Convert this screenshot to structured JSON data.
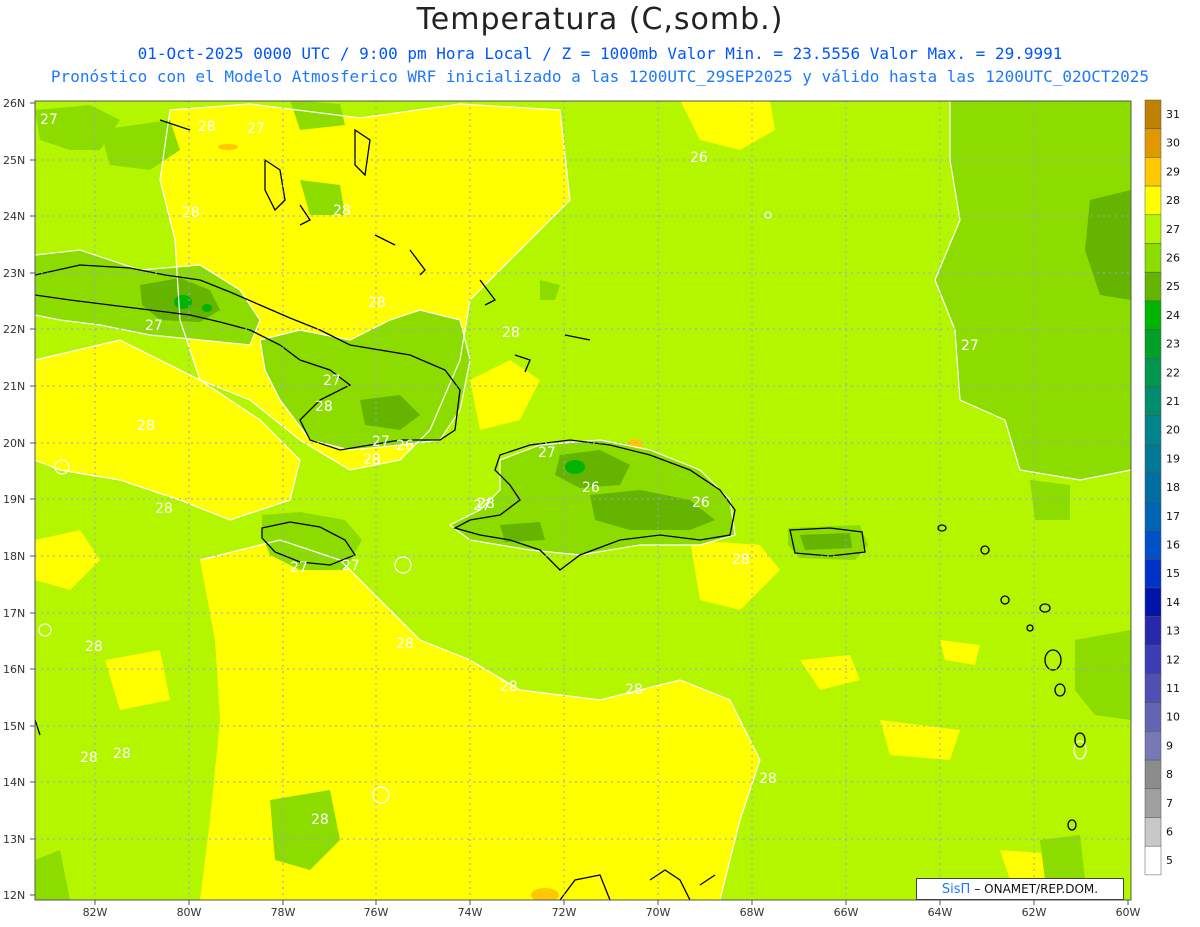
{
  "header": {
    "title": "Temperatura (C,somb.)",
    "subtitle1": "01-Oct-2025  0000 UTC / 9:00 pm Hora Local / Z = 1000mb   Valor Min. = 23.5556  Valor Max. = 29.9991",
    "subtitle2": "Pronóstico con el Modelo Atmosferico WRF inicializado a las 1200UTC_29SEP2025 y válido hasta las  1200UTC_02OCT2025"
  },
  "axes": {
    "lat_labels": [
      "26N",
      "25N",
      "24N",
      "23N",
      "22N",
      "21N",
      "20N",
      "19N",
      "18N",
      "17N",
      "16N",
      "15N",
      "14N",
      "13N",
      "12N"
    ],
    "lon_labels": [
      "82W",
      "80W",
      "78W",
      "76W",
      "74W",
      "72W",
      "70W",
      "68W",
      "66W",
      "64W",
      "62W",
      "60W"
    ]
  },
  "colorbar": {
    "labels": [
      "31",
      "30",
      "29",
      "28",
      "27",
      "26",
      "25",
      "24",
      "23",
      "22",
      "21",
      "20",
      "19",
      "18",
      "17",
      "16",
      "15",
      "14",
      "13",
      "12",
      "11",
      "10",
      "9",
      "8",
      "7",
      "6",
      "5"
    ],
    "colors": [
      "#c08000",
      "#e09800",
      "#ffc800",
      "#ffff00",
      "#b4f500",
      "#8cdc00",
      "#64b400",
      "#00b400",
      "#00a028",
      "#009650",
      "#008c6e",
      "#00848c",
      "#007896",
      "#006ea0",
      "#0064b4",
      "#0050c8",
      "#0032c8",
      "#0014aa",
      "#2828aa",
      "#3c3cb4",
      "#5050b4",
      "#6464b4",
      "#7878b4",
      "#8c8c8c",
      "#a0a0a0",
      "#c8c8c8",
      "#ffffff"
    ]
  },
  "contour_labels": [
    "27",
    "28",
    "27",
    "28",
    "28",
    "27",
    "28",
    "28",
    "26",
    "28",
    "27",
    "28",
    "27",
    "26",
    "28",
    "27",
    "26",
    "27",
    "26",
    "28",
    "28",
    "27",
    "27",
    "28",
    "28",
    "28",
    "28",
    "28",
    "28",
    "28",
    "28",
    "28",
    "27"
  ],
  "credit": {
    "brand": "SisΠ",
    "org": "– ONAMET/REP.DOM."
  }
}
